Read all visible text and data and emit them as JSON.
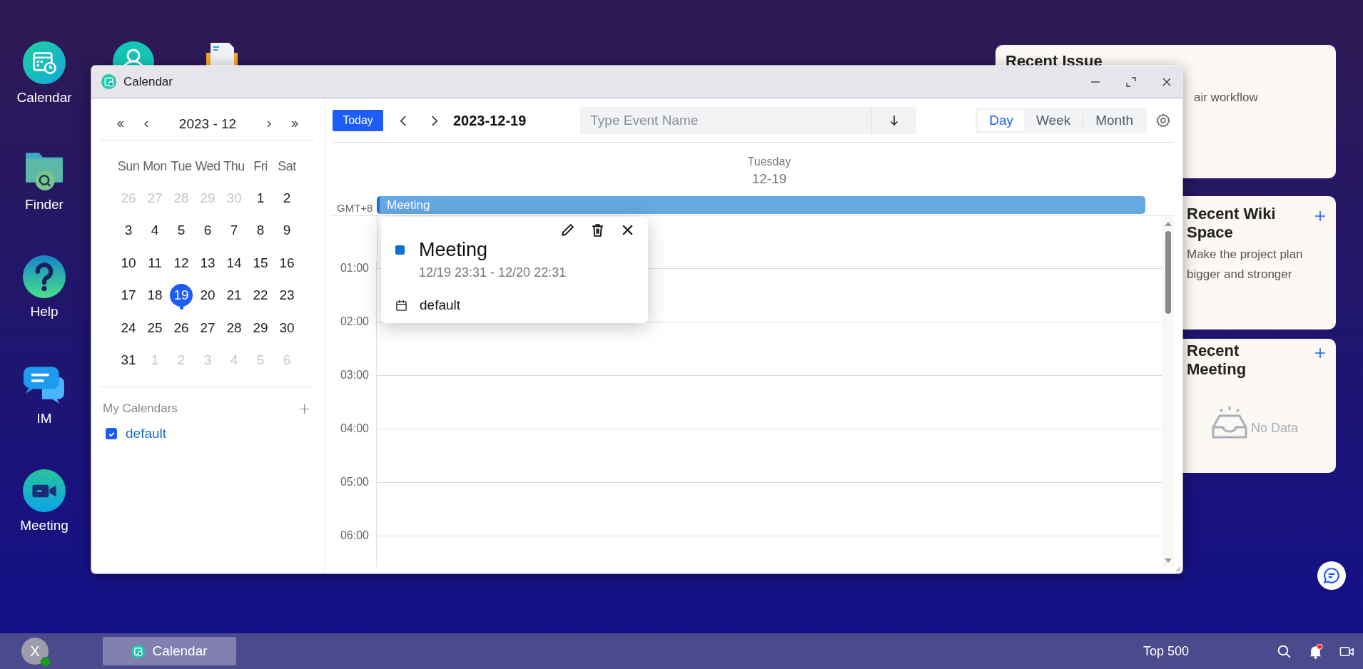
{
  "desktop_icons": [
    {
      "label": "Calendar",
      "kind": "calendar"
    },
    {
      "label": "Finder",
      "kind": "finder"
    },
    {
      "label": "Help",
      "kind": "help"
    },
    {
      "label": "IM",
      "kind": "im"
    },
    {
      "label": "Meeting",
      "kind": "meeting"
    }
  ],
  "widgets": [
    {
      "kind": "list",
      "title": "Recent Issue",
      "text": "air workflow",
      "add_button": false
    },
    {
      "kind": "list",
      "title": "Recent Wiki Space",
      "text": "Make the project plan bigger and stronger",
      "add_button": true
    },
    {
      "kind": "empty",
      "title": "Recent Meeting",
      "text": "No Data",
      "add_button": true
    }
  ],
  "window": {
    "title": "Calendar"
  },
  "mini_calendar": {
    "month": "2023 - 12",
    "weekdays": [
      "Sun",
      "Mon",
      "Tue",
      "Wed",
      "Thu",
      "Fri",
      "Sat"
    ],
    "days": [
      {
        "label": "26",
        "in_month": false,
        "selected": false,
        "has_event": false
      },
      {
        "label": "27",
        "in_month": false,
        "selected": false,
        "has_event": false
      },
      {
        "label": "28",
        "in_month": false,
        "selected": false,
        "has_event": false
      },
      {
        "label": "29",
        "in_month": false,
        "selected": false,
        "has_event": false
      },
      {
        "label": "30",
        "in_month": false,
        "selected": false,
        "has_event": false
      },
      {
        "label": "1",
        "in_month": true,
        "selected": false,
        "has_event": false
      },
      {
        "label": "2",
        "in_month": true,
        "selected": false,
        "has_event": false
      },
      {
        "label": "3",
        "in_month": true,
        "selected": false,
        "has_event": false
      },
      {
        "label": "4",
        "in_month": true,
        "selected": false,
        "has_event": false
      },
      {
        "label": "5",
        "in_month": true,
        "selected": false,
        "has_event": false
      },
      {
        "label": "6",
        "in_month": true,
        "selected": false,
        "has_event": false
      },
      {
        "label": "7",
        "in_month": true,
        "selected": false,
        "has_event": false
      },
      {
        "label": "8",
        "in_month": true,
        "selected": false,
        "has_event": false
      },
      {
        "label": "9",
        "in_month": true,
        "selected": false,
        "has_event": false
      },
      {
        "label": "10",
        "in_month": true,
        "selected": false,
        "has_event": false
      },
      {
        "label": "11",
        "in_month": true,
        "selected": false,
        "has_event": false
      },
      {
        "label": "12",
        "in_month": true,
        "selected": false,
        "has_event": false
      },
      {
        "label": "13",
        "in_month": true,
        "selected": false,
        "has_event": false
      },
      {
        "label": "14",
        "in_month": true,
        "selected": false,
        "has_event": false
      },
      {
        "label": "15",
        "in_month": true,
        "selected": false,
        "has_event": false
      },
      {
        "label": "16",
        "in_month": true,
        "selected": false,
        "has_event": false
      },
      {
        "label": "17",
        "in_month": true,
        "selected": false,
        "has_event": false
      },
      {
        "label": "18",
        "in_month": true,
        "selected": false,
        "has_event": false
      },
      {
        "label": "19",
        "in_month": true,
        "selected": true,
        "has_event": true
      },
      {
        "label": "20",
        "in_month": true,
        "selected": false,
        "has_event": false
      },
      {
        "label": "21",
        "in_month": true,
        "selected": false,
        "has_event": false
      },
      {
        "label": "22",
        "in_month": true,
        "selected": false,
        "has_event": false
      },
      {
        "label": "23",
        "in_month": true,
        "selected": false,
        "has_event": false
      },
      {
        "label": "24",
        "in_month": true,
        "selected": false,
        "has_event": false
      },
      {
        "label": "25",
        "in_month": true,
        "selected": false,
        "has_event": false
      },
      {
        "label": "26",
        "in_month": true,
        "selected": false,
        "has_event": false
      },
      {
        "label": "27",
        "in_month": true,
        "selected": false,
        "has_event": false
      },
      {
        "label": "28",
        "in_month": true,
        "selected": false,
        "has_event": false
      },
      {
        "label": "29",
        "in_month": true,
        "selected": false,
        "has_event": false
      },
      {
        "label": "30",
        "in_month": true,
        "selected": false,
        "has_event": false
      },
      {
        "label": "31",
        "in_month": true,
        "selected": false,
        "has_event": false
      },
      {
        "label": "1",
        "in_month": false,
        "selected": false,
        "has_event": false
      },
      {
        "label": "2",
        "in_month": false,
        "selected": false,
        "has_event": false
      },
      {
        "label": "3",
        "in_month": false,
        "selected": false,
        "has_event": false
      },
      {
        "label": "4",
        "in_month": false,
        "selected": false,
        "has_event": false
      },
      {
        "label": "5",
        "in_month": false,
        "selected": false,
        "has_event": false
      },
      {
        "label": "6",
        "in_month": false,
        "selected": false,
        "has_event": false
      }
    ]
  },
  "my_calendars": {
    "title": "My Calendars",
    "items": [
      {
        "name": "default",
        "checked": true
      }
    ]
  },
  "toolbar": {
    "today": "Today",
    "date": "2023-12-19",
    "search": {
      "placeholder": "Type Event Name"
    },
    "views": [
      {
        "label": "Day",
        "selected": true
      },
      {
        "label": "Week",
        "selected": false
      },
      {
        "label": "Month",
        "selected": false
      }
    ]
  },
  "day_header": {
    "weekday": "Tuesday",
    "date": "12-19"
  },
  "timezone": "GMT+8",
  "all_day_events": [
    {
      "title": "Meeting",
      "color": "#65a9e2"
    }
  ],
  "hours": [
    "01:00",
    "02:00",
    "03:00",
    "04:00",
    "05:00",
    "06:00"
  ],
  "popup": {
    "title": "Meeting",
    "time": "12/19 23:31 - 12/20 22:31",
    "calendar": "default",
    "color": "#0a6fd6"
  },
  "taskbar": {
    "avatar": "X",
    "online": true,
    "apps": [
      {
        "label": "Calendar",
        "selected": true
      }
    ],
    "label": "Top 500",
    "notification": true
  }
}
